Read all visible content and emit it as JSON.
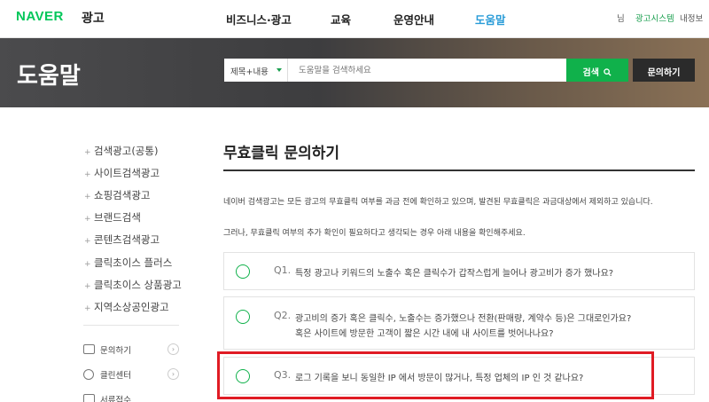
{
  "header": {
    "logo": "NAVER",
    "logo_sub": "광고",
    "nav": [
      {
        "label": "비즈니스·광고"
      },
      {
        "label": "교육"
      },
      {
        "label": "운영안내"
      },
      {
        "label": "도움말"
      }
    ],
    "util": {
      "user": "님",
      "ad_system": "광고시스템",
      "my_info": "내정보"
    }
  },
  "hero": {
    "title": "도움말",
    "search_scope": "제목+내용",
    "search_placeholder": "도움말을 검색하세요",
    "search_button": "검색",
    "ask_button": "문의하기"
  },
  "sidebar": {
    "items": [
      {
        "label": "검색광고(공통)"
      },
      {
        "label": "사이트검색광고"
      },
      {
        "label": "쇼핑검색광고"
      },
      {
        "label": "브랜드검색"
      },
      {
        "label": "콘텐츠검색광고"
      },
      {
        "label": "클릭초이스 플러스"
      },
      {
        "label": "클릭초이스 상품광고"
      },
      {
        "label": "지역소상공인광고"
      }
    ],
    "links": [
      {
        "label": "문의하기"
      },
      {
        "label": "클린센터"
      },
      {
        "label": "서류접수"
      }
    ]
  },
  "main": {
    "title": "무효클릭 문의하기",
    "paragraphs": [
      "네이버 검색광고는 모든 광고의 무효클릭 여부를 과금 전에 확인하고 있으며, 발견된 무효클릭은 과금대상에서 제외하고 있습니다.",
      "그러나, 무효클릭 여부의 추가 확인이 필요하다고 생각되는 경우 아래 내용을 확인해주세요."
    ],
    "faqs": [
      {
        "q": "Q1.",
        "lines": [
          "특정 광고나 키워드의 노출수 혹은 클릭수가 갑작스럽게 늘어나 광고비가 증가 했나요?"
        ]
      },
      {
        "q": "Q2.",
        "lines": [
          "광고비의 증가 혹은 클릭수, 노출수는 증가했으나 전환(판매량, 계약수 등)은 그대로인가요?",
          "혹은 사이트에 방문한 고객이 짧은 시간 내에 내 사이트를 벗어나나요?"
        ]
      },
      {
        "q": "Q3.",
        "lines": [
          "로그 기록을 보니 동일한 IP 에서 방문이 많거나, 특정 업체의 IP 인 것 같나요?"
        ]
      }
    ]
  },
  "colors": {
    "brand_green": "#03c75a",
    "active_blue": "#2a9cd8",
    "highlight_red": "#e01b24"
  }
}
